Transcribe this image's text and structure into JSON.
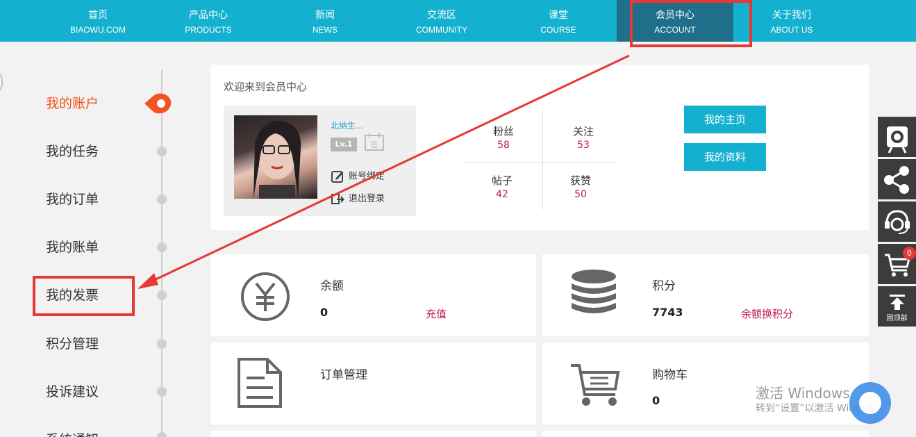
{
  "nav": [
    {
      "zh": "首页",
      "en": "BIAOWU.COM"
    },
    {
      "zh": "产品中心",
      "en": "PRODUCTS"
    },
    {
      "zh": "新闻",
      "en": "NEWS"
    },
    {
      "zh": "交流区",
      "en": "COMMUNITY"
    },
    {
      "zh": "课堂",
      "en": "COURSE"
    },
    {
      "zh": "会员中心",
      "en": "ACCOUNT"
    },
    {
      "zh": "关于我们",
      "en": "ABOUT US"
    }
  ],
  "sidebar": [
    "我的账户",
    "我的任务",
    "我的订单",
    "我的账单",
    "我的发票",
    "积分管理",
    "投诉建议",
    "系统通知"
  ],
  "welcome": {
    "title": "欢迎来到会员中心",
    "username": "北纳生...",
    "level": "Lv.1",
    "sign_glyph": "签",
    "bind_account": "账号绑定",
    "logout": "退出登录"
  },
  "stats": [
    {
      "label": "粉丝",
      "value": "58"
    },
    {
      "label": "关注",
      "value": "53"
    },
    {
      "label": "帖子",
      "value": "42"
    },
    {
      "label": "获赞",
      "value": "50"
    }
  ],
  "buttons": {
    "homepage": "我的主页",
    "profile": "我的资料"
  },
  "cards": {
    "balance": {
      "title": "余额",
      "value": "0",
      "action": "充值"
    },
    "points": {
      "title": "积分",
      "value": "7743",
      "action": "余额换积分"
    },
    "orders": {
      "title": "订单管理"
    },
    "cart": {
      "title": "购物车",
      "value": "0"
    }
  },
  "float_bar": {
    "cart_count": "0",
    "top_label": "回顶部"
  },
  "watermark": {
    "line1": "激活 Windows",
    "line2": "转到“设置”以激活 Windows。"
  },
  "colors": {
    "nav_bg": "#14b0cf",
    "nav_active": "#1f6f8b",
    "accent_orange": "#f2541f",
    "value_red": "#c2185b",
    "annotation_red": "#e53935"
  }
}
